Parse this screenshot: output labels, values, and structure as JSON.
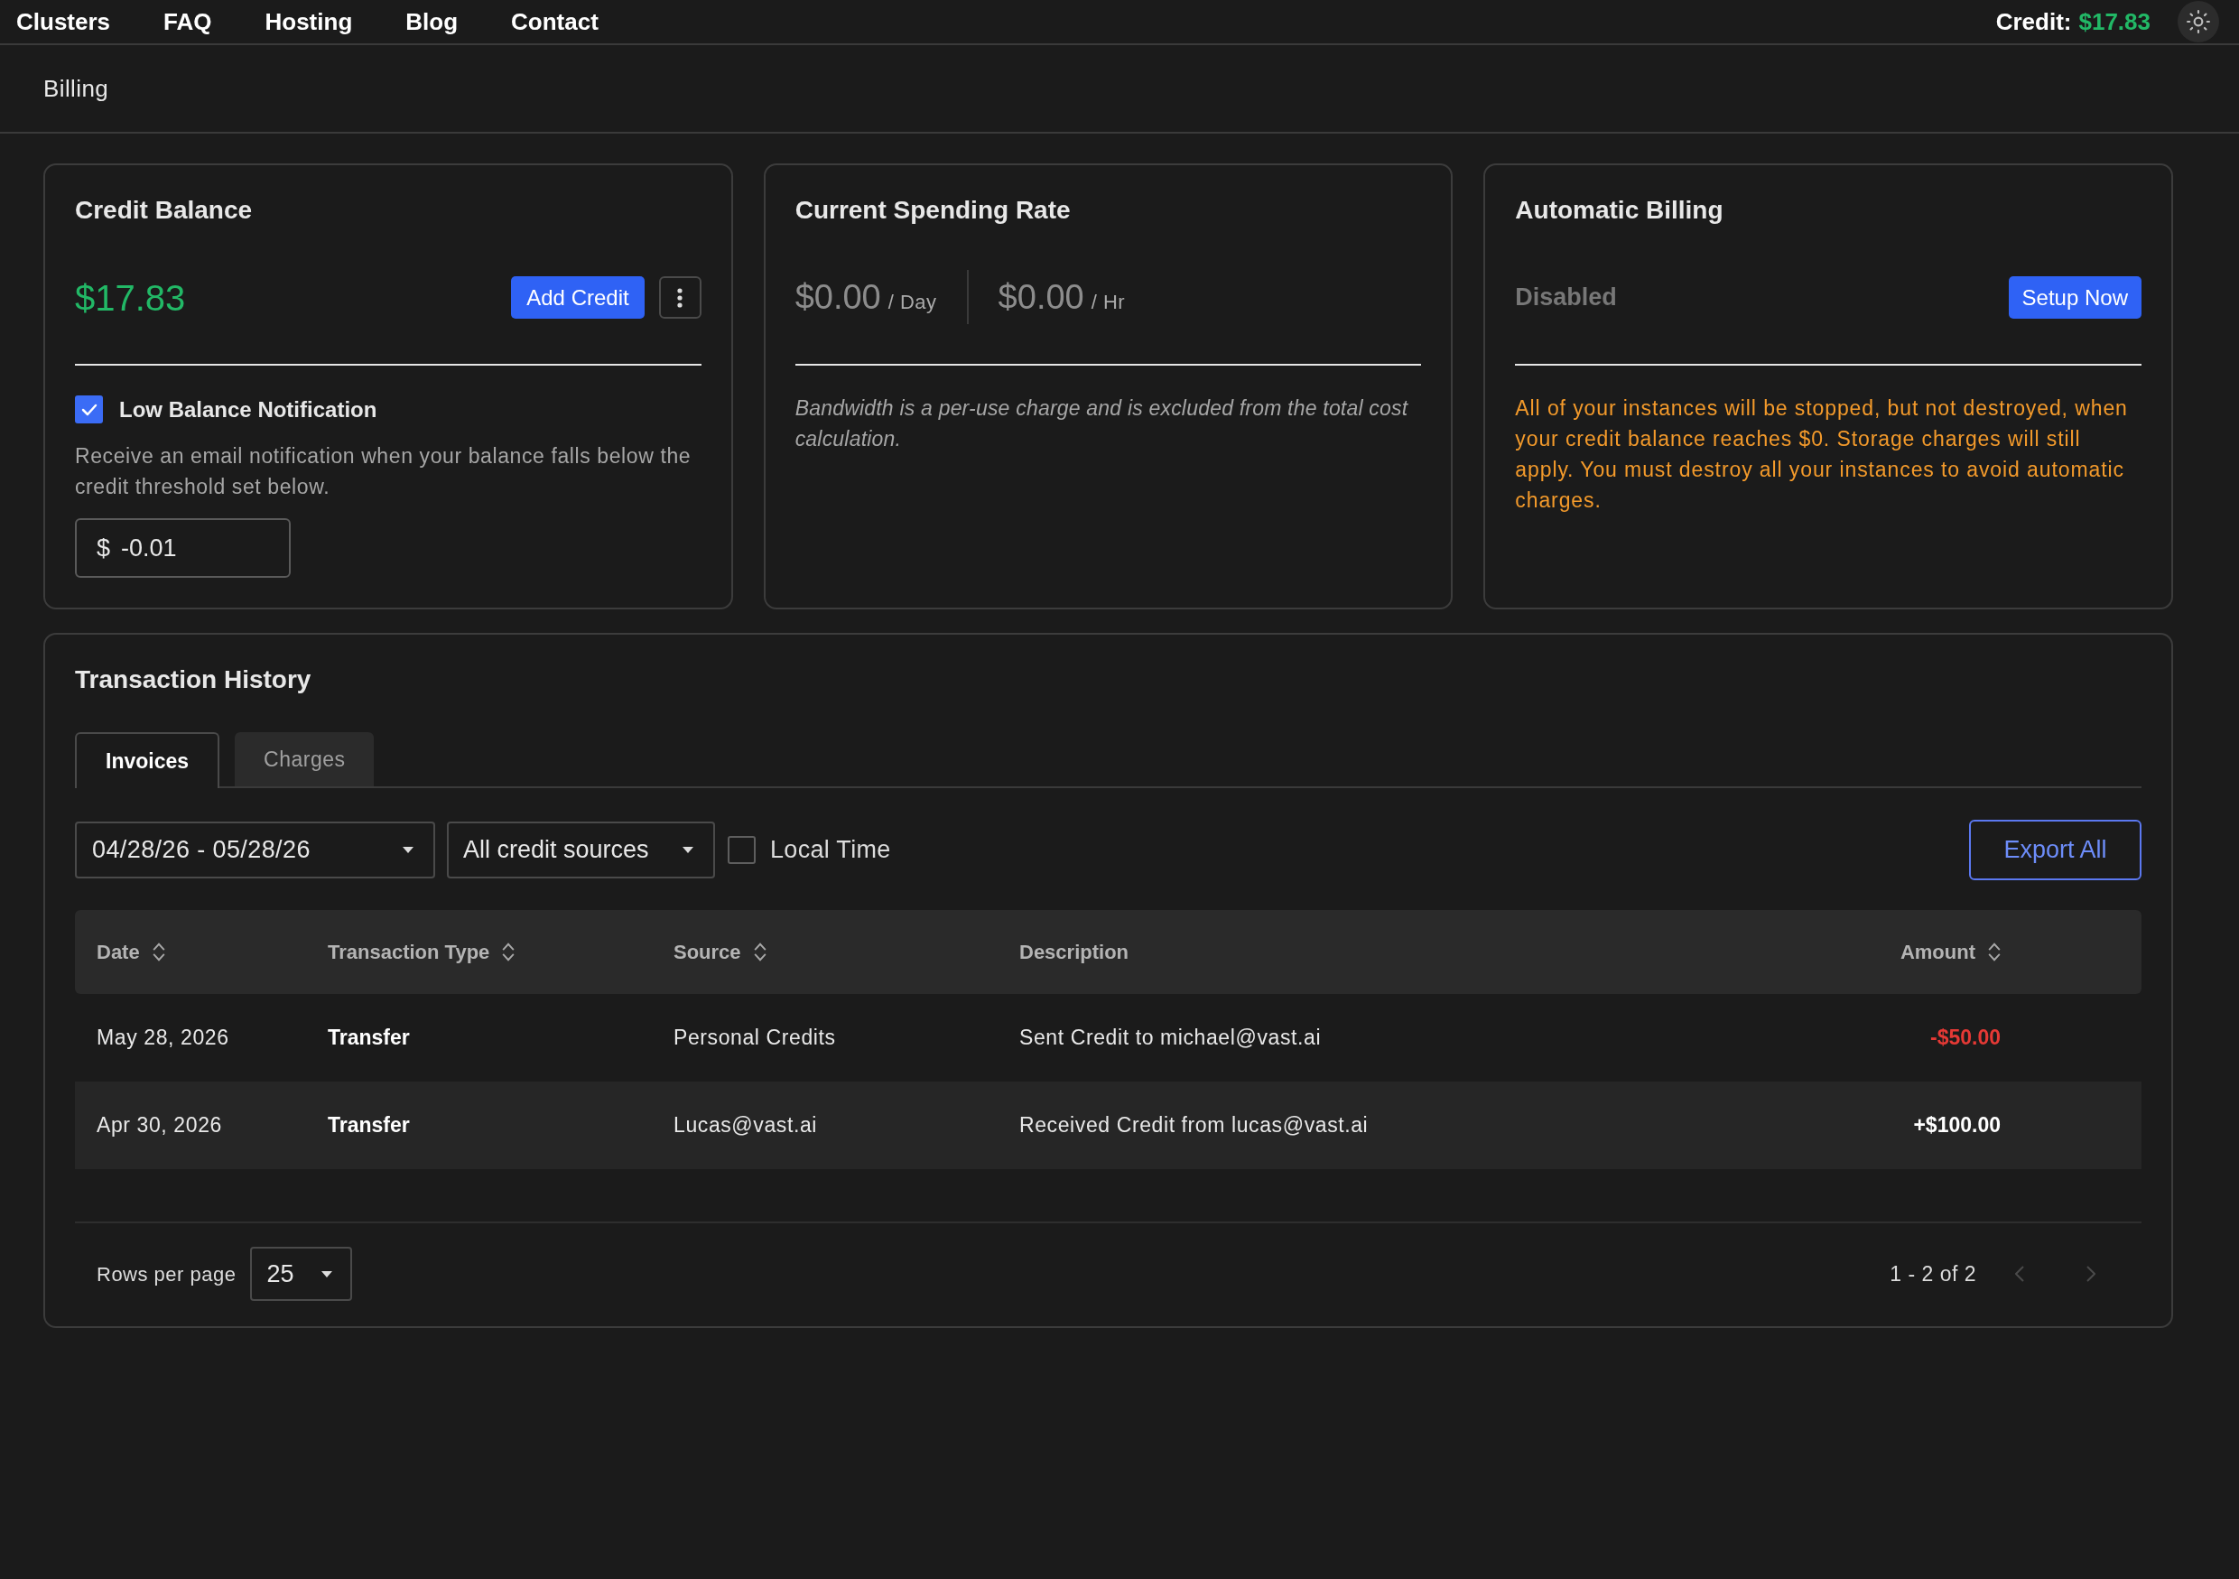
{
  "nav": {
    "items": [
      "Clusters",
      "FAQ",
      "Hosting",
      "Blog",
      "Contact"
    ],
    "credit_label": "Credit:",
    "credit_value": "$17.83"
  },
  "page_title": "Billing",
  "credit_balance": {
    "title": "Credit Balance",
    "amount": "$17.83",
    "add_button": "Add Credit",
    "notification": {
      "label": "Low Balance Notification",
      "checked": true,
      "description": "Receive an email notification when your balance falls below the credit threshold set below.",
      "currency": "$",
      "threshold": "-0.01"
    }
  },
  "spending_rate": {
    "title": "Current Spending Rate",
    "rates": [
      {
        "amount": "$0.00",
        "unit": "/ Day"
      },
      {
        "amount": "$0.00",
        "unit": "/ Hr"
      }
    ],
    "note": "Bandwidth is a per-use charge and is excluded from the total cost calculation."
  },
  "automatic_billing": {
    "title": "Automatic Billing",
    "status": "Disabled",
    "enabled": false,
    "button": "Setup Now",
    "warning": "All of your instances will be stopped, but not destroyed, when your credit balance reaches $0. Storage charges will still apply. You must destroy all your instances to avoid automatic charges."
  },
  "transactions": {
    "title": "Transaction History",
    "tabs": [
      {
        "label": "Invoices",
        "selected": true
      },
      {
        "label": "Charges",
        "selected": false
      }
    ],
    "filters": {
      "date_range": "04/28/26 - 05/28/26",
      "source": "All credit sources",
      "local_time": {
        "label": "Local Time",
        "checked": false
      }
    },
    "export_button": "Export All",
    "table": {
      "columns": [
        {
          "label": "Date",
          "sortable": true
        },
        {
          "label": "Transaction Type",
          "sortable": true
        },
        {
          "label": "Source",
          "sortable": true
        },
        {
          "label": "Description",
          "sortable": false
        },
        {
          "label": "Amount",
          "sortable": true
        }
      ],
      "rows": [
        {
          "date": "May 28, 2026",
          "type": "Transfer",
          "source": "Personal Credits",
          "description": "Sent Credit to michael@vast.ai",
          "amount": "-$50.00",
          "kind": "debit"
        },
        {
          "date": "Apr 30, 2026",
          "type": "Transfer",
          "source": "Lucas@vast.ai",
          "description": "Received Credit from lucas@vast.ai",
          "amount": "+$100.00",
          "kind": "credit"
        }
      ]
    },
    "pagination": {
      "rows_per_page_label": "Rows per page",
      "rows_per_page": "25",
      "range": "1 - 2 of 2",
      "previous": {
        "disabled": true
      },
      "next": {
        "disabled": true
      }
    }
  }
}
